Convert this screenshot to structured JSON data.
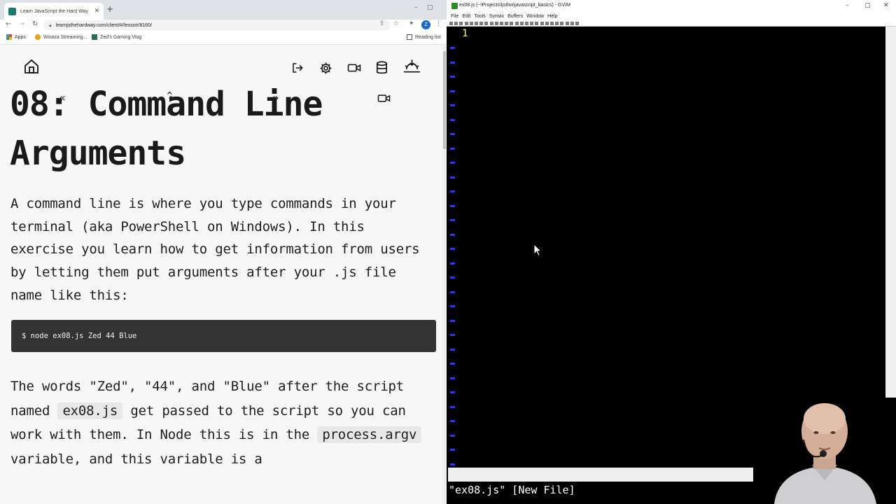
{
  "browser": {
    "tab_title": "Learn JavaScript the Hard Way",
    "url": "learnjsthehardway.com/client/#/lesson/8160/",
    "bookmarks": [
      "Apps",
      "Wowza Streaming...",
      "Zed's Gaming Vlog"
    ],
    "reading_list": "Reading list",
    "profile_initial": "Z"
  },
  "page": {
    "title": "08: Command Line Arguments",
    "para1": "A command line is where you type commands in your terminal (aka PowerShell on Windows). In this exercise you learn how to get information from users by letting them put arguments after your .js file name like this:",
    "code": "$ node ex08.js Zed 44 Blue",
    "para2_a": "The words \"Zed\", \"44\", and \"Blue\" after the script named ",
    "para2_code": "ex08.js",
    "para2_b": " get passed to the script so you can work with them. In Node this is in the ",
    "para2_code2": "process.argv",
    "para2_c": " variable, and this variable is a"
  },
  "gvim": {
    "title": "ex08.js (~\\Projects\\ljsthw\\javascript_basics) - GVIM",
    "menu": [
      "File",
      "Edit",
      "Tools",
      "Syntax",
      "Buffers",
      "Window",
      "Help"
    ],
    "line_number": "1",
    "cmdline": "\"ex08.js\" [New File]"
  },
  "colors": {
    "vim_background": "#000000",
    "vim_tilde": "#2e33ff",
    "vim_linenr": "#ffff66",
    "code_block_bg": "#333333"
  }
}
